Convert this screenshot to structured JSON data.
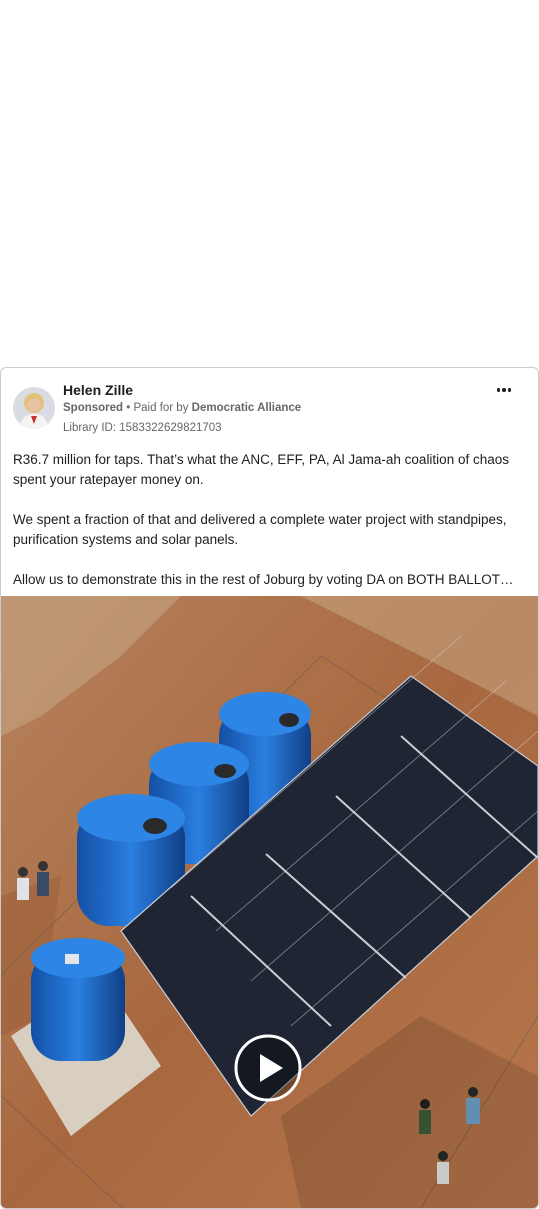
{
  "post": {
    "page_name": "Helen Zille",
    "sponsored_label": "Sponsored",
    "paid_for_by_prefix": " • Paid for by ",
    "payer_name": "Democratic Alliance",
    "library_id": "Library ID: 1583322629821703",
    "paragraphs": [
      "R36.7 million for taps. That’s what the ANC, EFF, PA, Al Jama-ah coalition of chaos spent your ratepayer money on.",
      "We spent a fraction of that and delivered a complete water project with standpipes, purification systems and solar panels.",
      "Allow us to demonstrate this in the rest of Joburg by voting DA on BOTH BALLOT…"
    ]
  },
  "icons": {
    "more": "more-horizontal-icon",
    "play": "play-icon"
  },
  "colors": {
    "tank_blue": "#1f6fd1",
    "ground": "#b0744d",
    "panel": "#1f2533"
  }
}
